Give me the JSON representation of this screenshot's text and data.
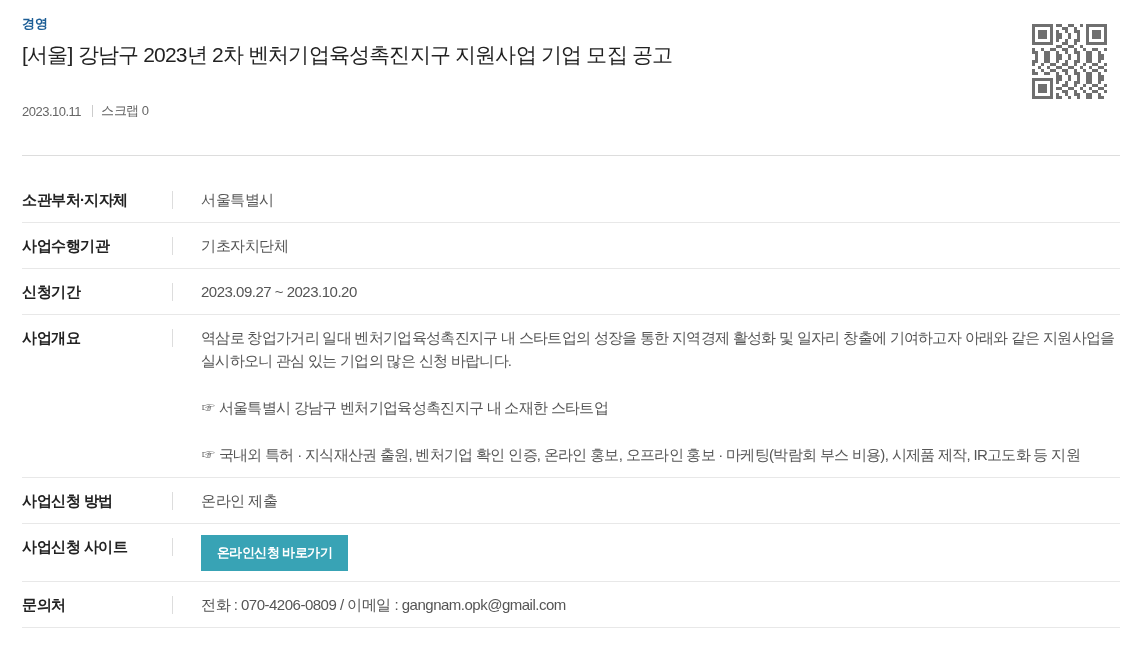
{
  "category": "경영",
  "title": "[서울] 강남구 2023년 2차 벤처기업육성촉진지구 지원사업 기업 모집 공고",
  "meta": {
    "date": "2023.10.11",
    "scrap": "스크랩 0"
  },
  "details": [
    {
      "kind": "text",
      "label": "소관부처·지자체",
      "value": "서울특별시"
    },
    {
      "kind": "text",
      "label": "사업수행기관",
      "value": "기초자치단체"
    },
    {
      "kind": "text",
      "label": "신청기간",
      "value": "2023.09.27 ~ 2023.10.20"
    },
    {
      "kind": "paragraphs",
      "label": "사업개요",
      "paragraphs": [
        "역삼로 창업가거리 일대 벤처기업육성촉진지구 내 스타트업의 성장을 통한 지역경제 활성화 및 일자리 창출에 기여하고자 아래와 같은 지원사업을 실시하오니 관심 있는 기업의 많은 신청 바랍니다.",
        "☞ 서울특별시 강남구 벤처기업육성촉진지구 내 소재한 스타트업",
        "☞ 국내외 특허 · 지식재산권 출원, 벤처기업 확인 인증, 온라인 홍보, 오프라인 홍보 · 마케팅(박람회 부스 비용), 시제품 제작, IR고도화 등 지원"
      ]
    },
    {
      "kind": "text",
      "label": "사업신청 방법",
      "value": "온라인 제출"
    },
    {
      "kind": "button",
      "label": "사업신청 사이트",
      "button": "온라인신청 바로가기"
    },
    {
      "kind": "text",
      "label": "문의처",
      "value": "전화 : 070-4206-0809 / 이메일 : gangnam.opk@gmail.com"
    }
  ]
}
